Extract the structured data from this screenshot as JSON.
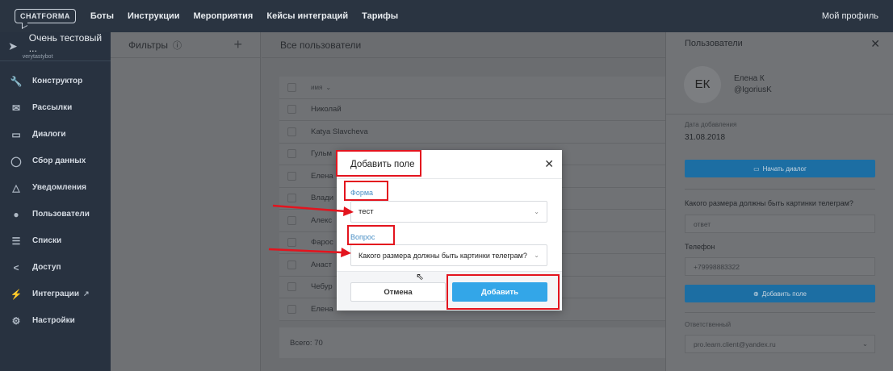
{
  "topbar": {
    "logo": "CHATFORMA",
    "nav": [
      "Боты",
      "Инструкции",
      "Мероприятия",
      "Кейсы интеграций",
      "Тарифы"
    ],
    "profile": "Мой профиль"
  },
  "sidebar": {
    "bot_name": "Очень тестовый ...",
    "bot_handle": "verytastybot",
    "items": [
      {
        "label": "Конструктор",
        "icon": "wrench-icon"
      },
      {
        "label": "Рассылки",
        "icon": "mail-icon"
      },
      {
        "label": "Диалоги",
        "icon": "chat-icon"
      },
      {
        "label": "Сбор данных",
        "icon": "circle-icon"
      },
      {
        "label": "Уведомления",
        "icon": "bell-icon"
      },
      {
        "label": "Пользователи",
        "icon": "users-icon"
      },
      {
        "label": "Списки",
        "icon": "list-icon"
      },
      {
        "label": "Доступ",
        "icon": "share-icon"
      },
      {
        "label": "Интеграции",
        "icon": "plug-icon"
      },
      {
        "label": "Настройки",
        "icon": "gear-icon"
      }
    ]
  },
  "filters": {
    "title": "Фильтры"
  },
  "main": {
    "title": "Все пользователи",
    "column_name": "имя",
    "rows": [
      "Николай",
      "Katya Slavcheva",
      "Гульм",
      "Елена",
      "Влади",
      "Алекс",
      "Фарос",
      "Анаст",
      "Чебур",
      "Елена"
    ],
    "total": "Всего: 70"
  },
  "panel": {
    "title": "Пользователи",
    "avatar": "ЕК",
    "user_name": "Елена К",
    "user_handle": "@IgoriusK",
    "date_label": "Дата добавления",
    "date_value": "31.08.2018",
    "start_dialog": "Начать диалог",
    "question": "Какого размера должны быть картинки телеграм?",
    "answer": "ответ",
    "phone_label": "Телефон",
    "phone_value": "+79998883322",
    "add_field": "Добавить поле",
    "responsible_label": "Ответственный",
    "responsible_value": "pro.learn.client@yandex.ru"
  },
  "dialog": {
    "title": "Добавить поле",
    "form_label": "Форма",
    "form_value": "тест",
    "question_label": "Вопрос",
    "question_value": "Какого размера должны быть картинки телеграм?",
    "cancel": "Отмена",
    "add": "Добавить"
  },
  "colors": {
    "annotation": "#e3141e",
    "primary": "#33a6e8",
    "sidebar": "#283240"
  }
}
